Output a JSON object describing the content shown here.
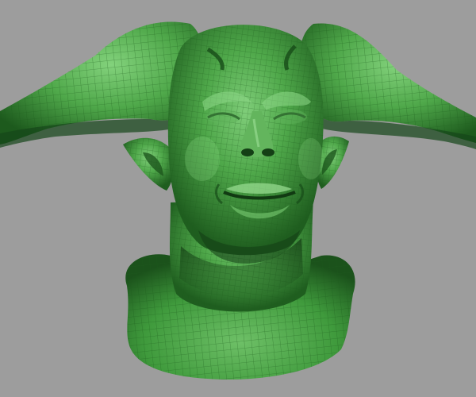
{
  "viewport": {
    "background": "#9d9d9d",
    "shading": "wireframe-on-shaded",
    "mesh_color": "#3f9a3c",
    "highlight_color": "#7ed07a",
    "shadow_color": "#0f3a10",
    "wire_color": "#1c5a1c"
  },
  "model": {
    "icon": "sculpt-head-icon"
  }
}
